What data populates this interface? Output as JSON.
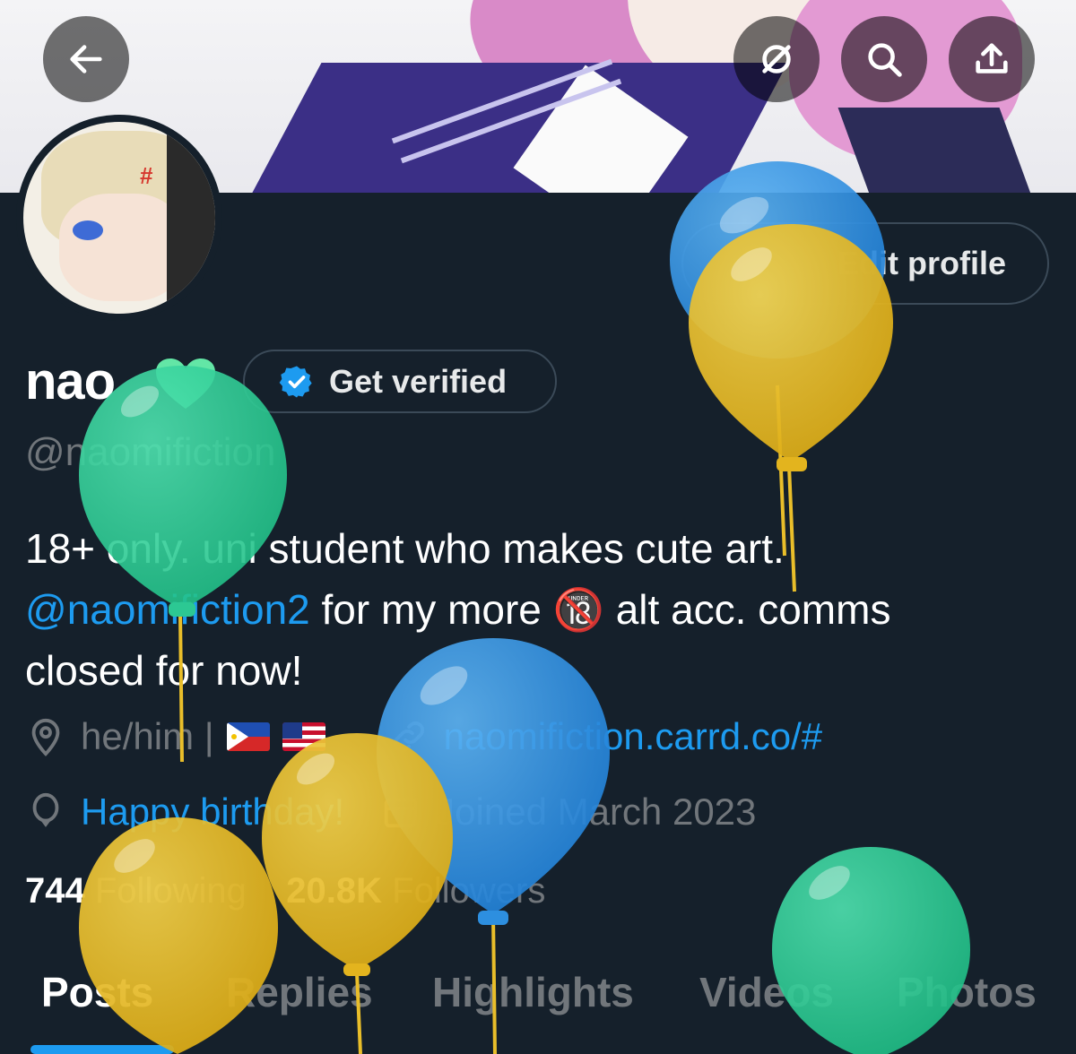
{
  "header": {
    "back_icon": "arrow-left-icon",
    "icons": [
      "hide-icon",
      "search-icon",
      "share-icon"
    ]
  },
  "profile": {
    "edit_label": "Edit profile",
    "name": "nao",
    "name_emoji": "💚",
    "verify_label": "Get verified",
    "handle": "@naomifiction",
    "bio_line1": "18+ only. uni student who makes cute art.",
    "bio_mention": "@naomifiction2",
    "bio_line2_rest": " for my more 🔞 alt acc. comms",
    "bio_line3": "closed for now!",
    "location": "he/him |",
    "website": "naomifiction.carrd.co/#",
    "birthday": "Happy birthday!",
    "joined": "Joined March 2023",
    "following_count": "744",
    "following_label": "Following",
    "followers_count": "20.8K",
    "followers_label": "Followers"
  },
  "tabs": [
    {
      "label": "Posts"
    },
    {
      "label": "Replies"
    },
    {
      "label": "Highlights"
    },
    {
      "label": "Videos"
    },
    {
      "label": "Photos"
    }
  ],
  "colors": {
    "accent": "#1d9bf0",
    "background": "#15202b",
    "muted": "#71767b",
    "balloon_blue": "#3b96e6",
    "balloon_yellow": "#e9be2a",
    "balloon_green": "#2fd19b"
  }
}
